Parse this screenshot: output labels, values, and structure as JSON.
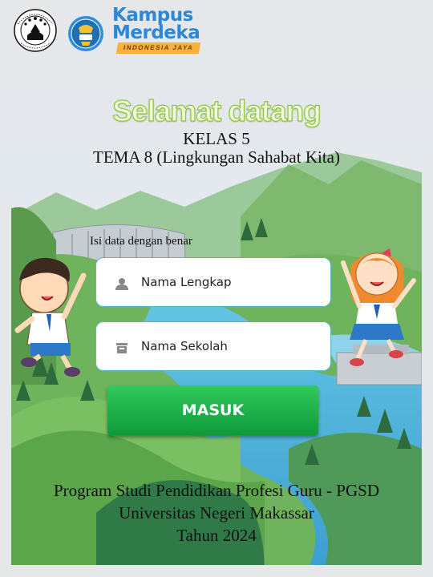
{
  "logos": {
    "kampus_line1": "Kampus",
    "kampus_line2": "Merdeka",
    "kampus_tagline": "INDONESIA JAYA"
  },
  "header": {
    "welcome": "Selamat datang",
    "kelas": "KELAS  5",
    "tema": "TEMA 8 (Lingkungan Sahabat Kita)"
  },
  "form": {
    "hint": "Isi data dengan benar",
    "name_placeholder": "Nama Lengkap",
    "name_value": "",
    "school_placeholder": "Nama Sekolah",
    "school_value": "",
    "submit_label": "MASUK"
  },
  "footer": {
    "line1": "Program Studi Pendidikan Profesi Guru - PGSD",
    "line2": "Universitas Negeri Makassar",
    "line3": "Tahun 2024"
  },
  "icons": {
    "name_field": "person-icon",
    "school_field": "school-icon"
  },
  "colors": {
    "welcome_text": "#f0f9d8",
    "welcome_outline": "#8dc63f",
    "button": "#1fb04a",
    "field_border": "#56b5c9",
    "brand_blue": "#2b88d8",
    "tagline_bg": "#f7b23a"
  }
}
